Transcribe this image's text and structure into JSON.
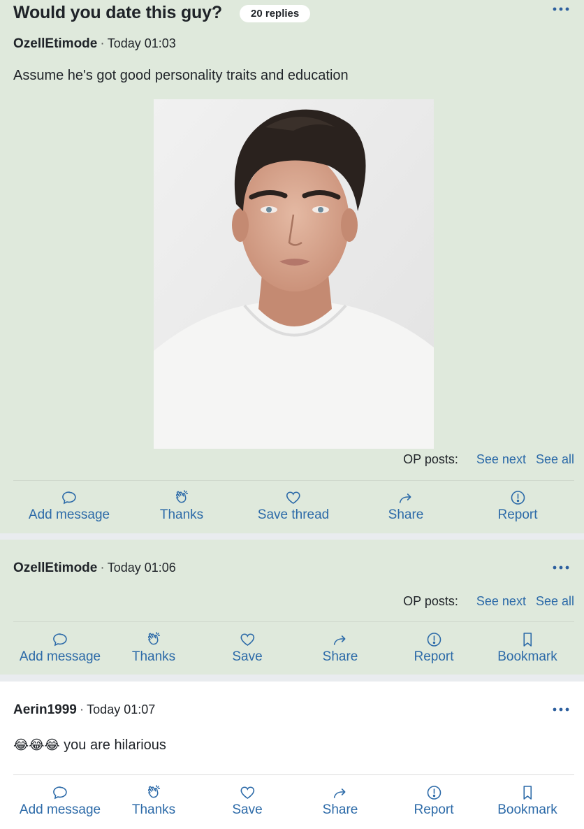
{
  "thread": {
    "title": "Would you date this guy?",
    "replies_badge": "20 replies"
  },
  "posts": [
    {
      "user": "OzellEtimode",
      "separator": "·",
      "time": "Today 01:03",
      "message": "Assume he's got good personality traits and education",
      "op_posts_label": "OP posts:",
      "see_next": "See next",
      "see_all": "See all",
      "actions": [
        "Add message",
        "Thanks",
        "Save thread",
        "Share",
        "Report"
      ]
    },
    {
      "user": "OzellEtimode",
      "separator": "·",
      "time": "Today 01:06",
      "op_posts_label": "OP posts:",
      "see_next": "See next",
      "see_all": "See all",
      "actions": [
        "Add message",
        "Thanks",
        "Save",
        "Share",
        "Report",
        "Bookmark"
      ]
    },
    {
      "user": "Aerin1999",
      "separator": "·",
      "time": "Today 01:07",
      "emoji": "😂😂😂",
      "message": "you are hilarious",
      "actions": [
        "Add message",
        "Thanks",
        "Save",
        "Share",
        "Report",
        "Bookmark"
      ]
    }
  ],
  "colors": {
    "op_post_bg": "#dfe9dc",
    "reply_bg": "#ffffff",
    "link": "#2c6aa8"
  },
  "icons": [
    "speech-bubble-icon",
    "clapping-hands-icon",
    "heart-icon",
    "share-arrow-icon",
    "report-exclamation-icon",
    "bookmark-icon",
    "more-dots-icon"
  ]
}
